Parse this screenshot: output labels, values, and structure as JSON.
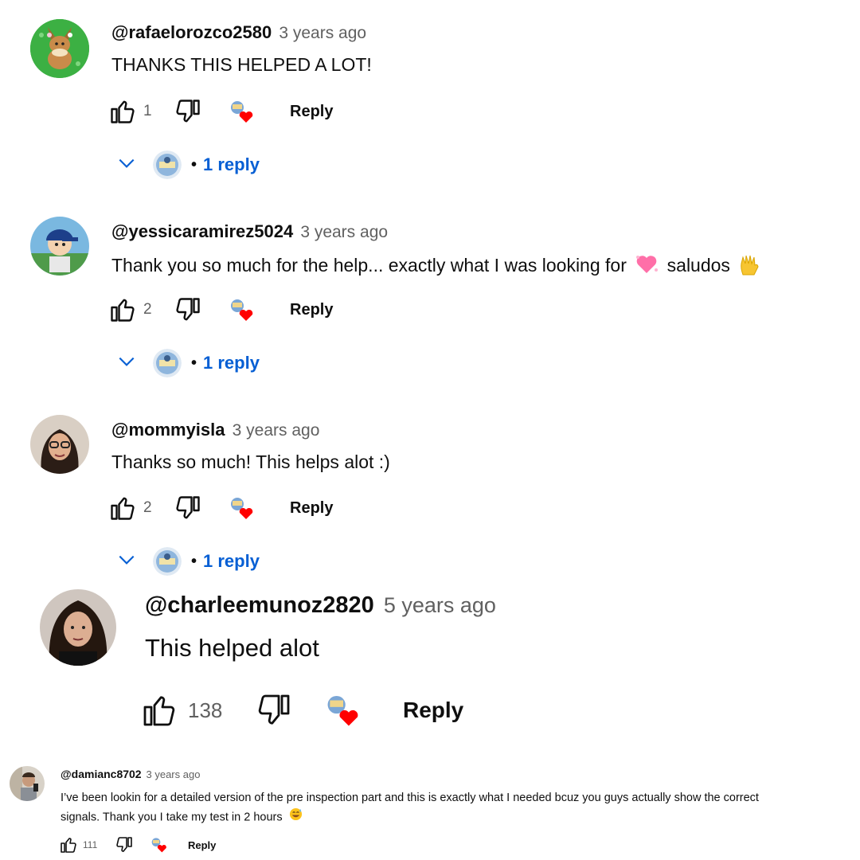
{
  "comments": [
    {
      "author": "@rafaelorozco2580",
      "time": "3 years ago",
      "text": "THANKS THIS HELPED A LOT!",
      "likes": "1",
      "reply_label": "Reply",
      "replies_label": "1 reply"
    },
    {
      "author": "@yessicaramirez5024",
      "time": "3 years ago",
      "text_before": "Thank you so much for the help... exactly what I was looking for",
      "text_mid": "saludos",
      "likes": "2",
      "reply_label": "Reply",
      "replies_label": "1 reply"
    },
    {
      "author": "@mommyisla",
      "time": "3 years ago",
      "text": "Thanks so much! This helps alot :)",
      "likes": "2",
      "reply_label": "Reply",
      "replies_label": "1 reply"
    },
    {
      "author": "@charleemunoz2820",
      "time": "5 years ago",
      "text": "This helped alot",
      "likes": "138",
      "reply_label": "Reply"
    },
    {
      "author": "@damianc8702",
      "time": "3 years ago",
      "text_line1": "I’ve been lookin for a detailed version of the pre inspection part and this is exactly what I needed bcuz you guys actually show the correct",
      "text_line2": "signals. Thank you I take my test in 2 hours",
      "likes": "111",
      "reply_label": "Reply"
    }
  ],
  "reply_separator": "•",
  "colors": {
    "link_blue": "#065fd4",
    "heart_red": "#ff0000",
    "muted_text": "#606060"
  },
  "icons": [
    "like-icon",
    "dislike-icon",
    "creator-heart-icon",
    "chevron-down-icon",
    "avatar"
  ]
}
